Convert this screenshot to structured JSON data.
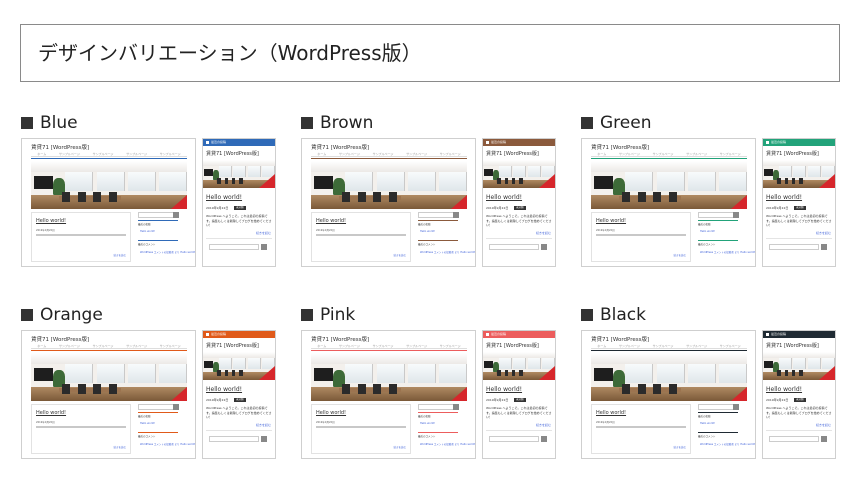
{
  "page": {
    "title": "デザインバリエーション（WordPress版）"
  },
  "preview": {
    "site_title": "賃貸71 [WordPress版]",
    "nav": [
      "ホーム",
      "サンプルページ",
      "サンプルページ",
      "サンプルページ",
      "サンプルページ"
    ],
    "post_title": "Hello world!",
    "post_date": "2019年9月22日",
    "badge": "未分類",
    "post_text": "WordPress へようこそ。これは最初の投稿です。編集もしくは削除してブログを始めてください！",
    "read_more": "続きを読む",
    "meta_line": "2019年9月22日",
    "side_recent": "最近の投稿",
    "side_recent_link": "Hello world!",
    "side_comments": "最近のコメント",
    "side_comments_link": "WordPress コメントの投稿者 より Hello world!"
  },
  "variants": [
    {
      "name": "Blue",
      "color": "#2f6ab8"
    },
    {
      "name": "Brown",
      "color": "#8b5a3c"
    },
    {
      "name": "Green",
      "color": "#22a37a"
    },
    {
      "name": "Orange",
      "color": "#e05a1a"
    },
    {
      "name": "Pink",
      "color": "#ec5d5d"
    },
    {
      "name": "Black",
      "color": "#1f2a33"
    }
  ]
}
